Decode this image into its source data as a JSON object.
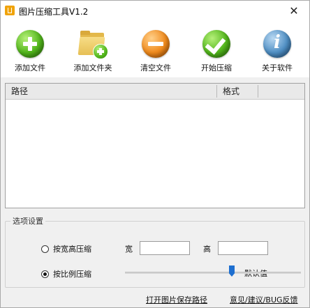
{
  "window": {
    "title": "图片压缩工具V1.2",
    "close_glyph": "✕"
  },
  "toolbar": {
    "add_file": "添加文件",
    "add_folder": "添加文件夹",
    "clear_files": "清空文件",
    "start_compress": "开始压缩",
    "about": "关于软件"
  },
  "icons": {
    "add_file": "plus-circle-icon",
    "add_folder": "folder-plus-icon",
    "clear_files": "minus-circle-icon",
    "start_compress": "checkmark-circle-icon",
    "about": "info-circle-icon"
  },
  "file_list": {
    "columns": [
      "路径",
      "格式"
    ],
    "rows": []
  },
  "options": {
    "group_title": "选项设置",
    "resize_by_dimensions": {
      "label": "按宽高压缩",
      "selected": false
    },
    "width_label": "宽",
    "width_value": "",
    "height_label": "高",
    "height_value": "",
    "resize_by_ratio": {
      "label": "按比例压缩",
      "selected": true
    },
    "slider": {
      "value_label": "默认值",
      "position_fraction": 0.6
    }
  },
  "footer": {
    "open_save_path": "打开图片保存路径",
    "feedback": "意见/建议/BUG反馈"
  },
  "colors": {
    "accent": "#1e6fd0",
    "window_bg": "#f0f0f0"
  }
}
